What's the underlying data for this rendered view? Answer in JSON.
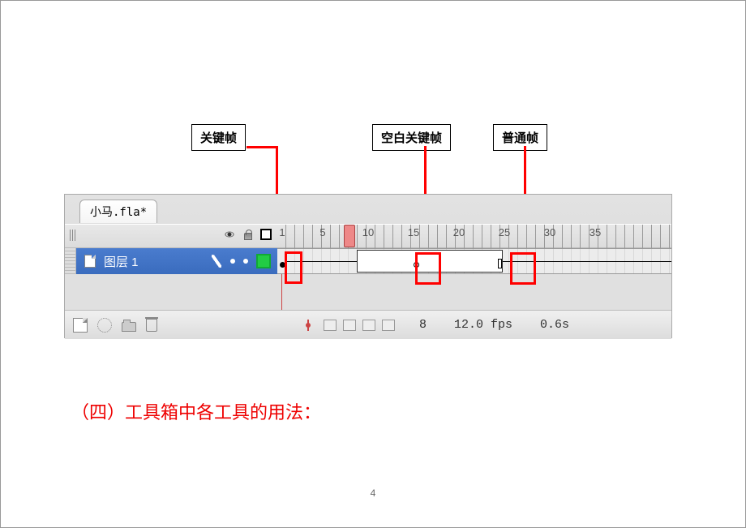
{
  "annotations": {
    "keyframe": "关键帧",
    "blank_keyframe": "空白关键帧",
    "normal_frame": "普通帧"
  },
  "file": {
    "tab_name": "小马.fla*"
  },
  "ruler": {
    "first": "1",
    "ticks": [
      "5",
      "10",
      "15",
      "20",
      "25",
      "30",
      "35"
    ]
  },
  "layer": {
    "name": "图层 1"
  },
  "footer": {
    "current_frame": "8",
    "fps": "12.0 fps",
    "elapsed": "0.6s"
  },
  "heading": "（四）工具箱中各工具的用法：",
  "page_number": "4"
}
